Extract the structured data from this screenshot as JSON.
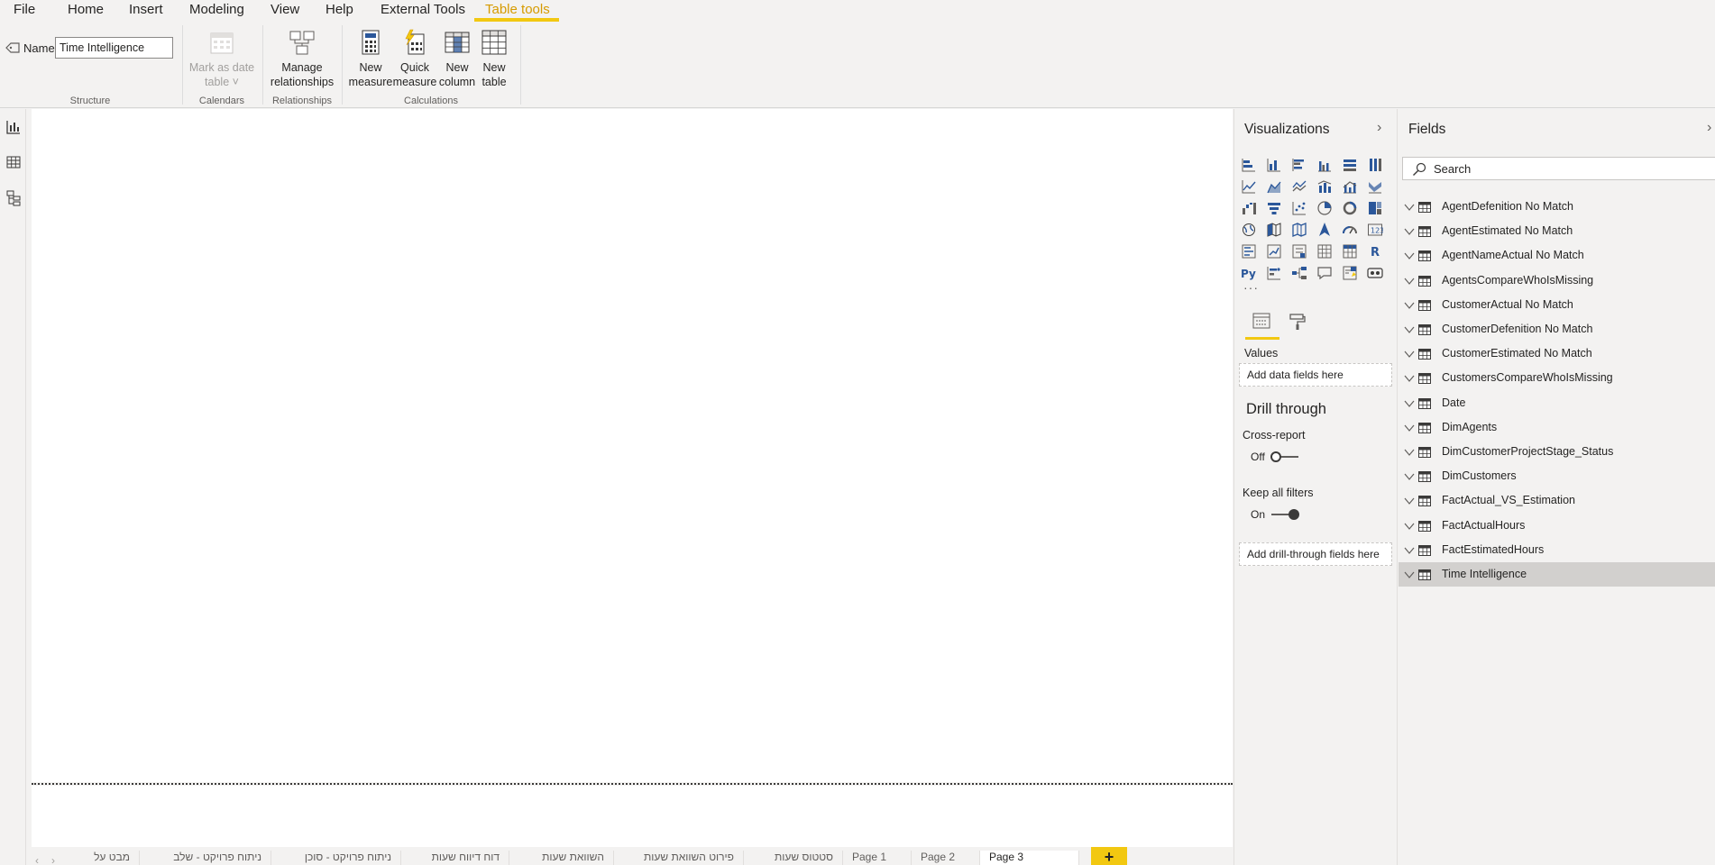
{
  "menu": {
    "items": [
      "File",
      "Home",
      "Insert",
      "Modeling",
      "View",
      "Help",
      "External Tools",
      "Table tools"
    ],
    "active": "Table tools"
  },
  "ribbon": {
    "name_label": "Name",
    "name_value": "Time Intelligence",
    "groups": {
      "structure": "Structure",
      "calendars": "Calendars",
      "relationships": "Relationships",
      "calculations": "Calculations"
    },
    "buttons": {
      "mark_as_date_table": [
        "Mark as date",
        "table ˅"
      ],
      "manage_relationships": [
        "Manage",
        "relationships"
      ],
      "new_measure": [
        "New",
        "measure"
      ],
      "quick_measure": [
        "Quick",
        "measure"
      ],
      "new_column": [
        "New",
        "column"
      ],
      "new_table": [
        "New",
        "table"
      ]
    }
  },
  "visualizations": {
    "title": "Visualizations",
    "more": "···",
    "values_label": "Values",
    "values_placeholder": "Add data fields here",
    "drill_through": {
      "title": "Drill through",
      "cross_report_label": "Cross-report",
      "cross_report_state": "Off",
      "keep_filters_label": "Keep all filters",
      "keep_filters_state": "On",
      "drill_placeholder": "Add drill-through fields here"
    },
    "accent": "#f2c811",
    "icon_color": "#2b579a"
  },
  "fields": {
    "title": "Fields",
    "search_placeholder": "Search",
    "tables": [
      "AgentDefenition No Match",
      "AgentEstimated No Match",
      "AgentNameActual No Match",
      "AgentsCompareWhoIsMissing",
      "CustomerActual No Match",
      "CustomerDefenition No Match",
      "CustomerEstimated No Match",
      "CustomersCompareWhoIsMissing",
      "Date",
      "DimAgents",
      "DimCustomerProjectStage_Status",
      "DimCustomers",
      "FactActual_VS_Estimation",
      "FactActualHours",
      "FactEstimatedHours",
      "Time Intelligence"
    ],
    "selected": "Time Intelligence"
  },
  "pages": {
    "tabs": [
      "מבט על",
      "ניתוח פרויקט - שלב",
      "ניתוח פרויקט - סוכן",
      "דוח דיווח שעות",
      "השוואת שעות",
      "פירוט השוואת שעות",
      "סטטוס שעות",
      "Page 1",
      "Page 2",
      "Page 3"
    ],
    "current": "Page 3",
    "add_label": "+"
  }
}
